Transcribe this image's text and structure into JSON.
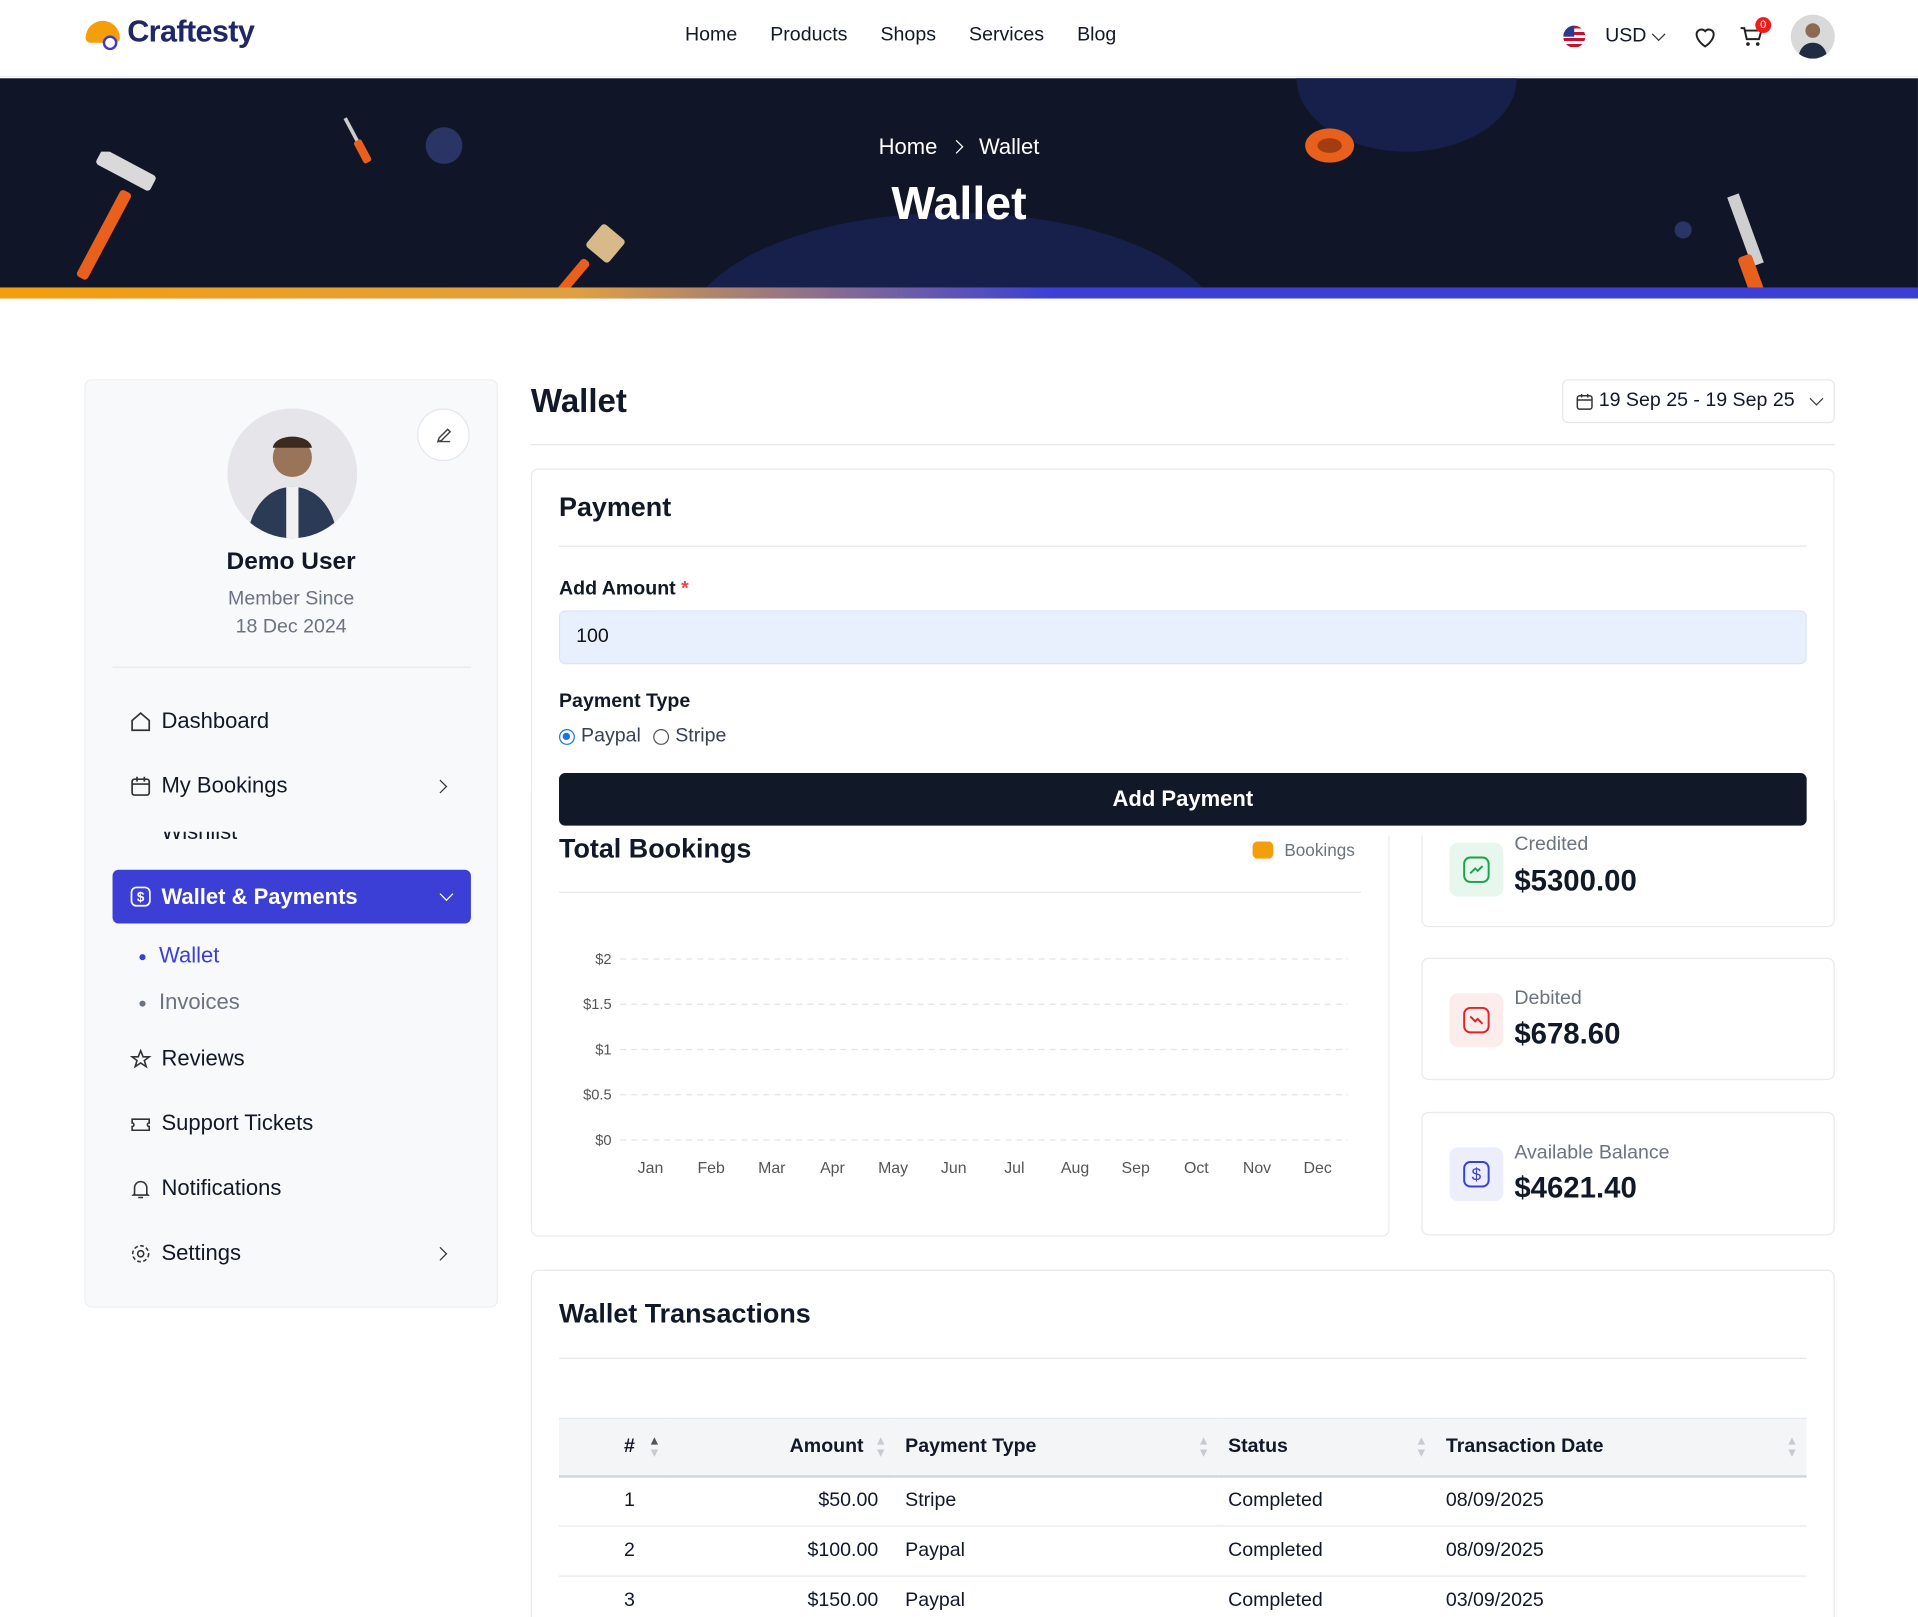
{
  "header": {
    "logo_text": "Craftesty",
    "nav": [
      "Home",
      "Products",
      "Shops",
      "Services",
      "Blog"
    ],
    "currency": "USD",
    "cart_count": "0"
  },
  "banner": {
    "breadcrumb_home": "Home",
    "breadcrumb_current": "Wallet",
    "title": "Wallet"
  },
  "profile": {
    "name": "Demo User",
    "member_since_label": "Member Since",
    "member_since_date": "18 Dec 2024"
  },
  "sidebar": {
    "items": {
      "dashboard": "Dashboard",
      "bookings": "My Bookings",
      "wishlist": "Wishlist",
      "wallet_payments": "Wallet & Payments",
      "wallet": "Wallet",
      "invoices": "Invoices",
      "reviews": "Reviews",
      "tickets": "Support Tickets",
      "notifications": "Notifications",
      "settings": "Settings"
    }
  },
  "main": {
    "title": "Wallet",
    "date_range": "19 Sep 25 - 19 Sep 25"
  },
  "payment": {
    "title": "Payment",
    "amount_label": "Add Amount",
    "amount_required": "*",
    "amount_value": "100",
    "type_label": "Payment Type",
    "options": [
      "Paypal",
      "Stripe"
    ],
    "selected": "Paypal",
    "submit": "Add Payment"
  },
  "stats": {
    "credited_label": "Credited",
    "credited_value": "$5300.00",
    "debited_label": "Debited",
    "debited_value": "$678.60",
    "balance_label": "Available Balance",
    "balance_value": "$4621.40"
  },
  "colors": {
    "accent": "#3b3fd6",
    "legend": "#f59e0b",
    "credited": "#16a34a",
    "debited": "#dc2626",
    "balance": "#3b3fd6"
  },
  "chart_data": {
    "type": "bar",
    "title": "Total Bookings",
    "categories": [
      "Jan",
      "Feb",
      "Mar",
      "Apr",
      "May",
      "Jun",
      "Jul",
      "Aug",
      "Sep",
      "Oct",
      "Nov",
      "Dec"
    ],
    "series": [
      {
        "name": "Bookings",
        "values": [
          0,
          0,
          0,
          0,
          0,
          0,
          0,
          0,
          0,
          0,
          0,
          0
        ]
      }
    ],
    "y_ticks": [
      "$0",
      "$0.5",
      "$1",
      "$1.5",
      "$2"
    ],
    "ylim": [
      0,
      2
    ],
    "grid": "dashed horizontal",
    "legend": "top-right"
  },
  "transactions": {
    "title": "Wallet Transactions",
    "columns": [
      "#",
      "Amount",
      "Payment Type",
      "Status",
      "Transaction Date"
    ],
    "rows": [
      [
        "1",
        "$50.00",
        "Stripe",
        "Completed",
        "08/09/2025"
      ],
      [
        "2",
        "$100.00",
        "Paypal",
        "Completed",
        "08/09/2025"
      ],
      [
        "3",
        "$150.00",
        "Paypal",
        "Completed",
        "03/09/2025"
      ]
    ]
  }
}
